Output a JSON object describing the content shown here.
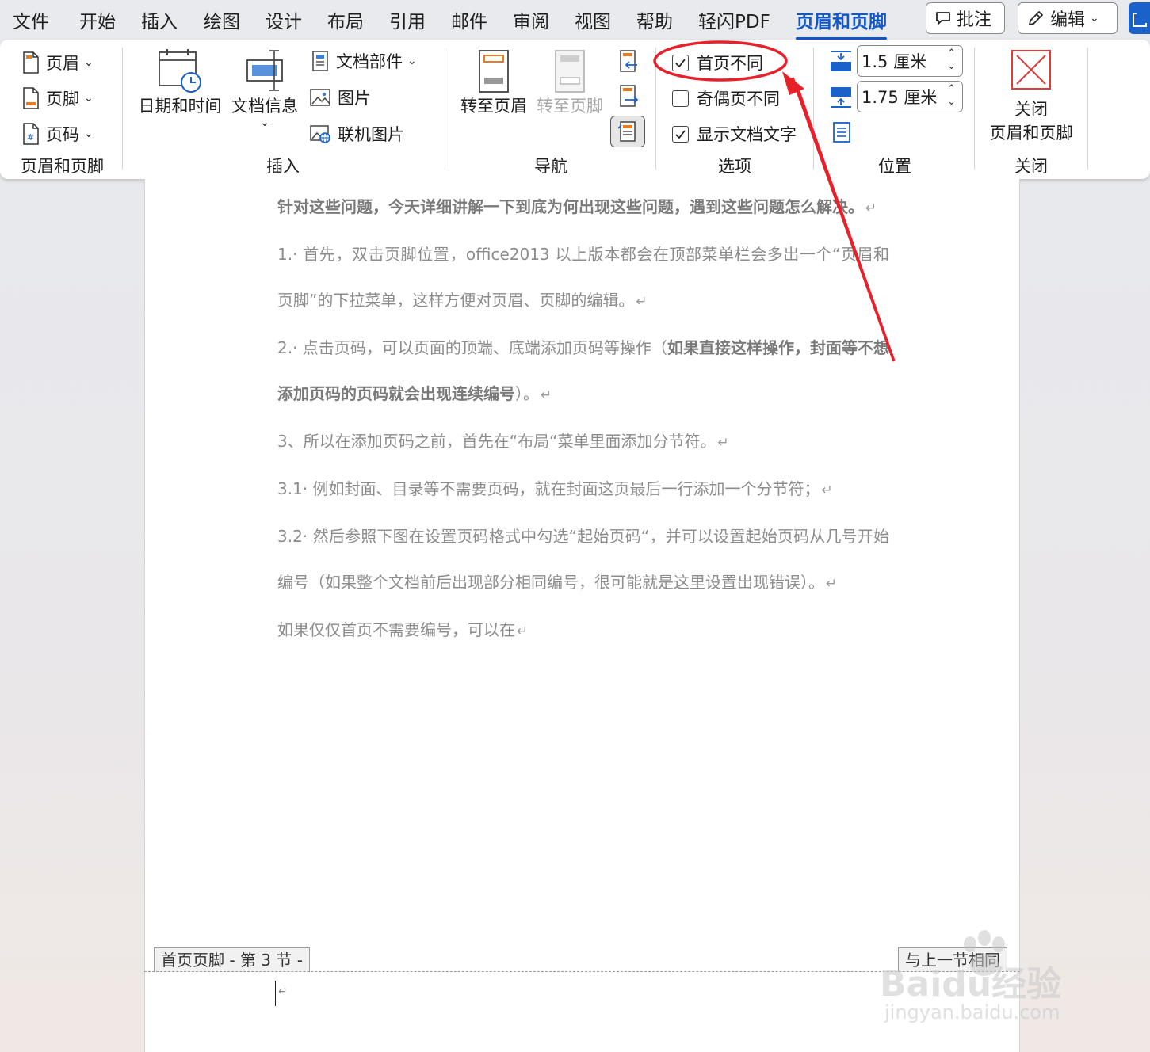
{
  "menu": {
    "tabs": [
      "文件",
      "开始",
      "插入",
      "绘图",
      "设计",
      "布局",
      "引用",
      "邮件",
      "审阅",
      "视图",
      "帮助",
      "轻闪PDF",
      "页眉和页脚"
    ],
    "active_tab": "页眉和页脚",
    "comment_button": "批注",
    "edit_button": "编辑"
  },
  "ribbon": {
    "header_footer_group": {
      "label": "页眉和页脚",
      "header": "页眉",
      "footer": "页脚",
      "page_number": "页码"
    },
    "insert_group": {
      "label": "插入",
      "date_time": "日期和时间",
      "doc_info": "文档信息",
      "doc_parts": "文档部件",
      "picture": "图片",
      "online_picture": "联机图片"
    },
    "nav_group": {
      "label": "导航",
      "goto_header": "转至页眉",
      "goto_footer": "转至页脚"
    },
    "options_group": {
      "label": "选项",
      "first_page_diff": "首页不同",
      "odd_even_diff": "奇偶页不同",
      "show_doc_text": "显示文档文字",
      "first_page_diff_checked": true,
      "odd_even_diff_checked": false,
      "show_doc_text_checked": true
    },
    "position_group": {
      "label": "位置",
      "header_top": "1.5 厘米",
      "footer_bottom": "1.75 厘米"
    },
    "close_group": {
      "label": "关闭",
      "close_line1": "关闭",
      "close_line2": "页眉和页脚"
    }
  },
  "document": {
    "p1_bold": "针对这些问题，今天详细讲解一下到底为何出现这些问题，遇到这些问题怎么解决。",
    "p2": "1.· 首先，双击页脚位置，office2013 以上版本都会在顶部菜单栏会多出一个“页眉和页脚”的下拉菜单，这样方便对页眉、页脚的编辑。",
    "p3_plain": "2.· 点击页码，可以页面的顶端、底端添加页码等操作（",
    "p3_bold": "如果直接这样操作，封面等不想添加页码的页码就会出现连续编号",
    "p3_end": "）。",
    "p4": "3、所以在添加页码之前，首先在“布局“菜单里面添加分节符。",
    "p5": "3.1· 例如封面、目录等不需要页码，就在封面这页最后一行添加一个分节符；",
    "p6": "3.2· 然后参照下图在设置页码格式中勾选“起始页码“，并可以设置起始页码从几号开始编号（如果整个文档前后出现部分相同编号，很可能就是这里设置出现错误）。",
    "p7": "如果仅仅首页不需要编号，可以在",
    "para_mark": "↵"
  },
  "footer": {
    "left_tag": "首页页脚 - 第 3 节 -",
    "right_tag": "与上一节相同"
  },
  "watermark": {
    "brand": "Baidu经验",
    "url": "jingyan.baidu.com"
  },
  "colors": {
    "accent": "#1257c7",
    "annotation": "#e8202a"
  }
}
